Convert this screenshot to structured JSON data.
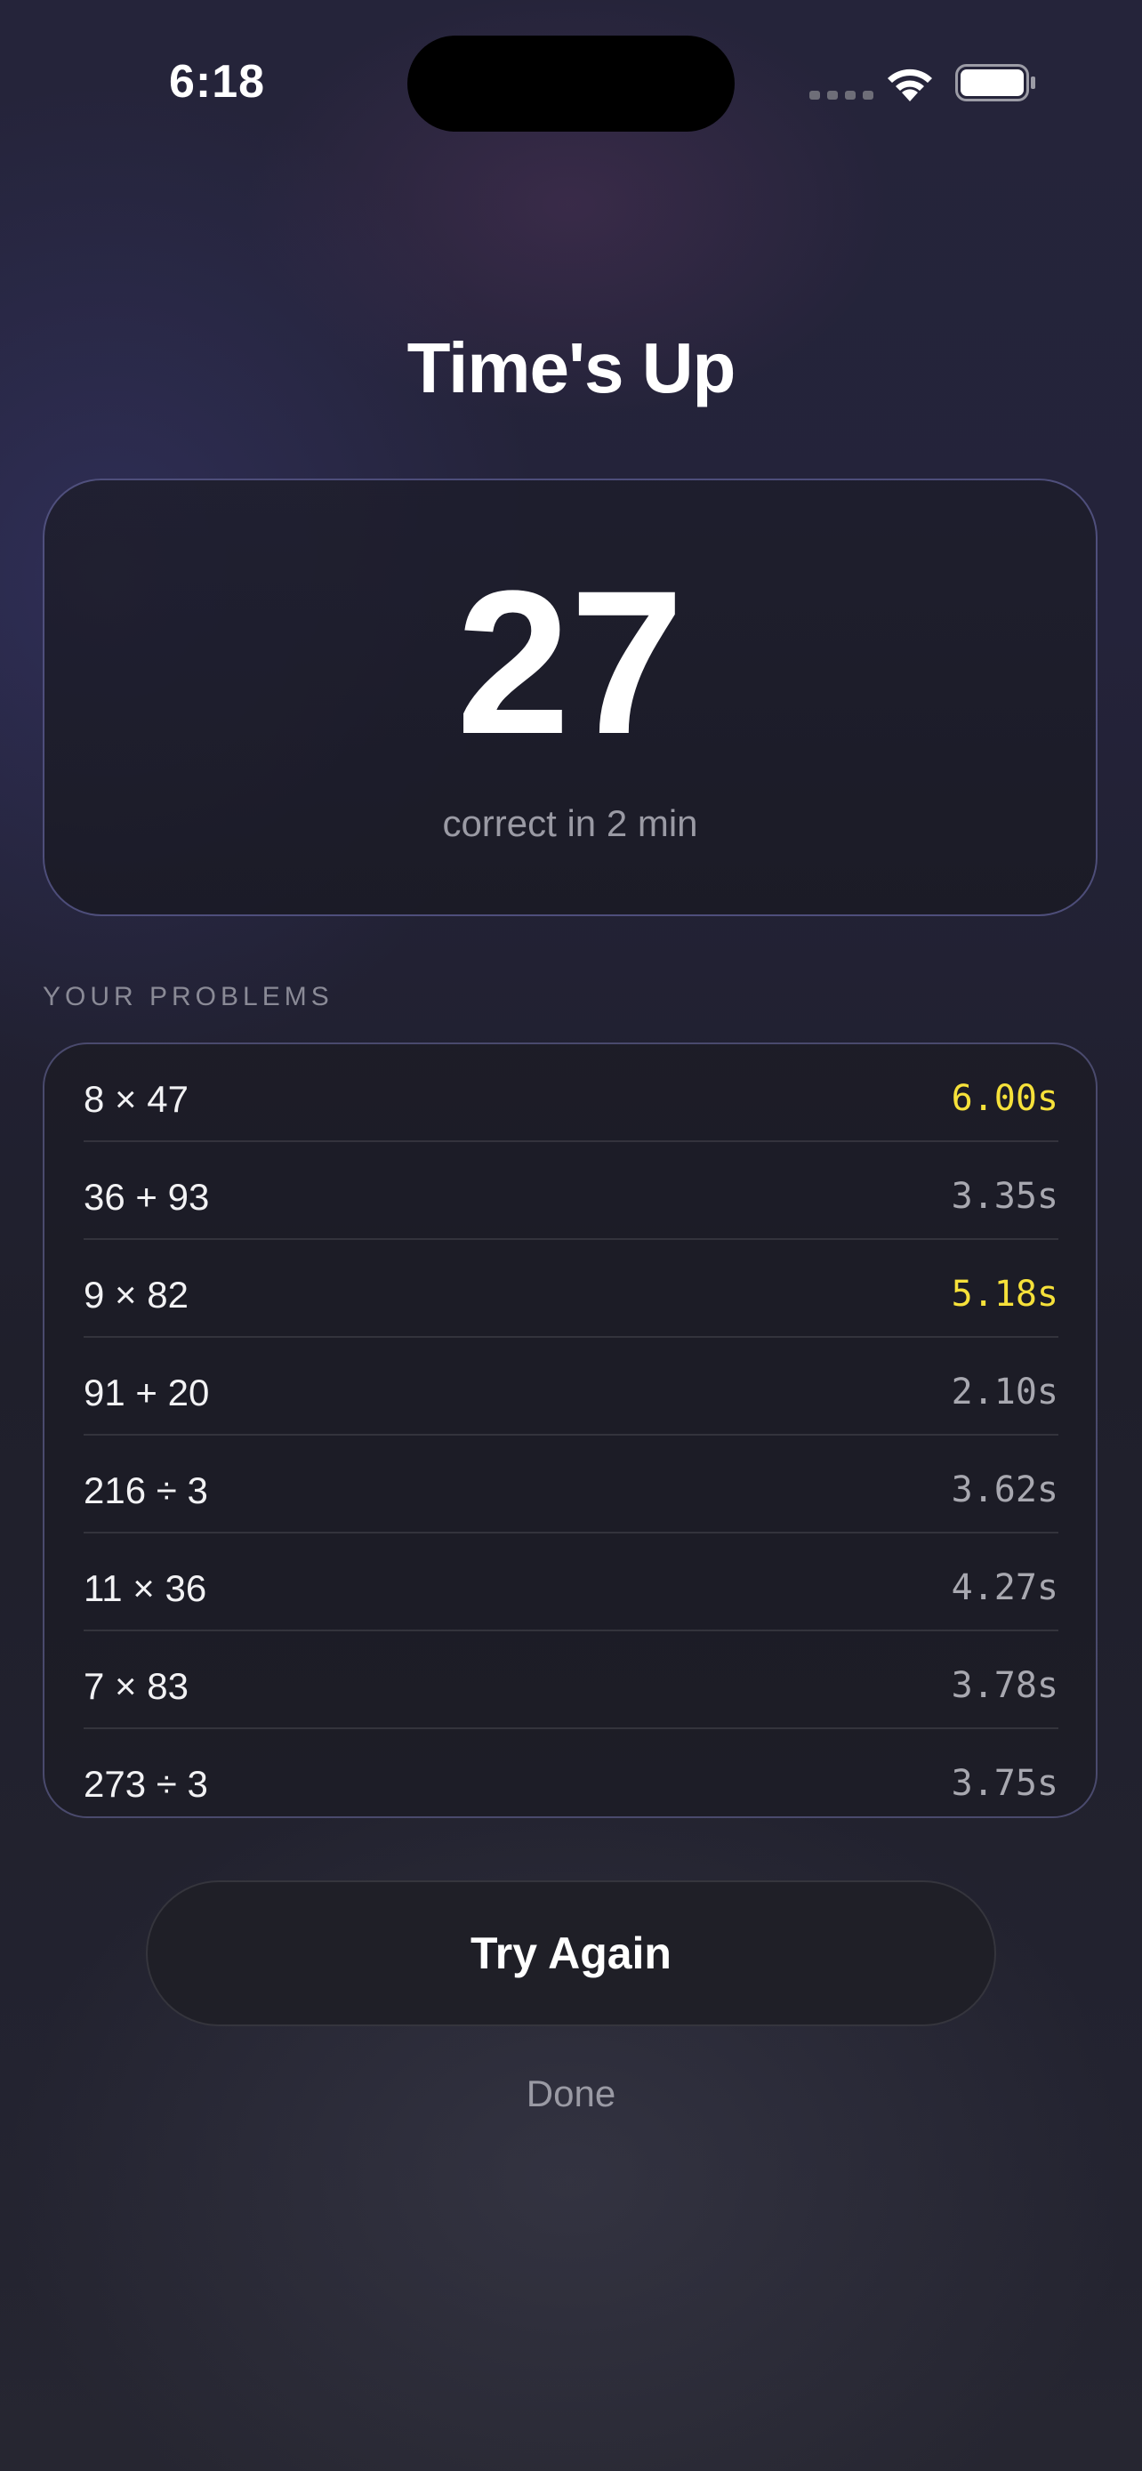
{
  "status_bar": {
    "time": "6:18"
  },
  "header": {
    "title": "Time's Up"
  },
  "score": {
    "value": "27",
    "caption": "correct in 2 min"
  },
  "problems": {
    "section_label": "YOUR PROBLEMS",
    "items": [
      {
        "expression": "8 × 47",
        "time": "6.00s",
        "highlight": true
      },
      {
        "expression": "36 + 93",
        "time": "3.35s",
        "highlight": false
      },
      {
        "expression": "9 × 82",
        "time": "5.18s",
        "highlight": true
      },
      {
        "expression": "91 + 20",
        "time": "2.10s",
        "highlight": false
      },
      {
        "expression": "216 ÷ 3",
        "time": "3.62s",
        "highlight": false
      },
      {
        "expression": "11 × 36",
        "time": "4.27s",
        "highlight": false
      },
      {
        "expression": "7 × 83",
        "time": "3.78s",
        "highlight": false
      },
      {
        "expression": "273 ÷ 3",
        "time": "3.75s",
        "highlight": false
      }
    ]
  },
  "actions": {
    "try_again_label": "Try Again",
    "done_label": "Done"
  },
  "colors": {
    "highlight_time": "#f6e13a",
    "normal_time": "#a8a8b0"
  }
}
